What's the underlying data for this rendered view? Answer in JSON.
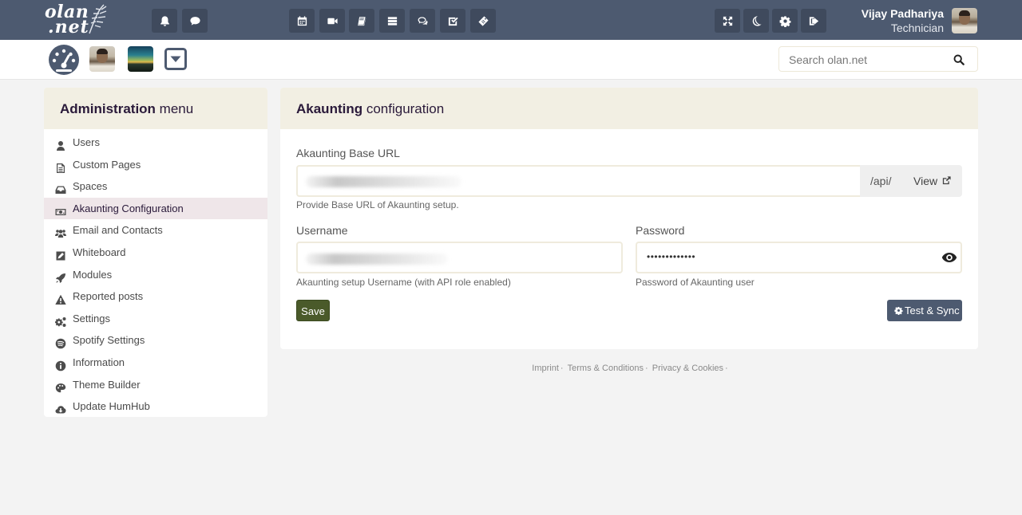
{
  "topbar": {
    "logo_line1": "olan",
    "logo_line2": ".net",
    "user_name": "Vijay Padhariya",
    "user_role": "Technician",
    "left_icons": [
      "bell-icon",
      "chat-bubble-icon"
    ],
    "center_icons": [
      "calendar-icon",
      "video-icon",
      "book-icon",
      "list-icon",
      "comments-icon",
      "tasks-check-icon",
      "tag-icon"
    ],
    "right_icons": [
      "fullscreen-icon",
      "moon-icon",
      "gear-icon",
      "sign-out-icon"
    ]
  },
  "subbar": {
    "search_placeholder": "Search olan.net"
  },
  "sidebar": {
    "title_bold": "Administration",
    "title_rest": " menu",
    "items": [
      {
        "label": "Users",
        "icon": "user-icon"
      },
      {
        "label": "Custom Pages",
        "icon": "file-text-icon"
      },
      {
        "label": "Spaces",
        "icon": "inbox-icon"
      },
      {
        "label": "Akaunting Configuration",
        "icon": "money-icon",
        "active": true
      },
      {
        "label": "Email and Contacts",
        "icon": "users-icon"
      },
      {
        "label": "Whiteboard",
        "icon": "pencil-square-icon"
      },
      {
        "label": "Modules",
        "icon": "rocket-icon"
      },
      {
        "label": "Reported posts",
        "icon": "warning-icon"
      },
      {
        "label": "Settings",
        "icon": "gears-icon"
      },
      {
        "label": "Spotify Settings",
        "icon": "spotify-icon"
      },
      {
        "label": "Information",
        "icon": "info-icon"
      },
      {
        "label": "Theme Builder",
        "icon": "palette-icon"
      },
      {
        "label": "Update HumHub",
        "icon": "cloud-download-icon"
      }
    ]
  },
  "panel": {
    "title_bold": "Akaunting",
    "title_rest": " configuration",
    "base_url": {
      "label": "Akaunting Base URL",
      "suffix": "/api/",
      "view_label": "View",
      "help": "Provide Base URL of Akaunting setup."
    },
    "username": {
      "label": "Username",
      "help": "Akaunting setup Username (with API role enabled)"
    },
    "password": {
      "label": "Password",
      "value": "•••••••••••••",
      "help": "Password of Akaunting user"
    },
    "save_label": "Save",
    "sync_label": "Test & Sync"
  },
  "footer": {
    "links": [
      "Imprint",
      "Terms & Conditions",
      "Privacy & Cookies"
    ]
  }
}
